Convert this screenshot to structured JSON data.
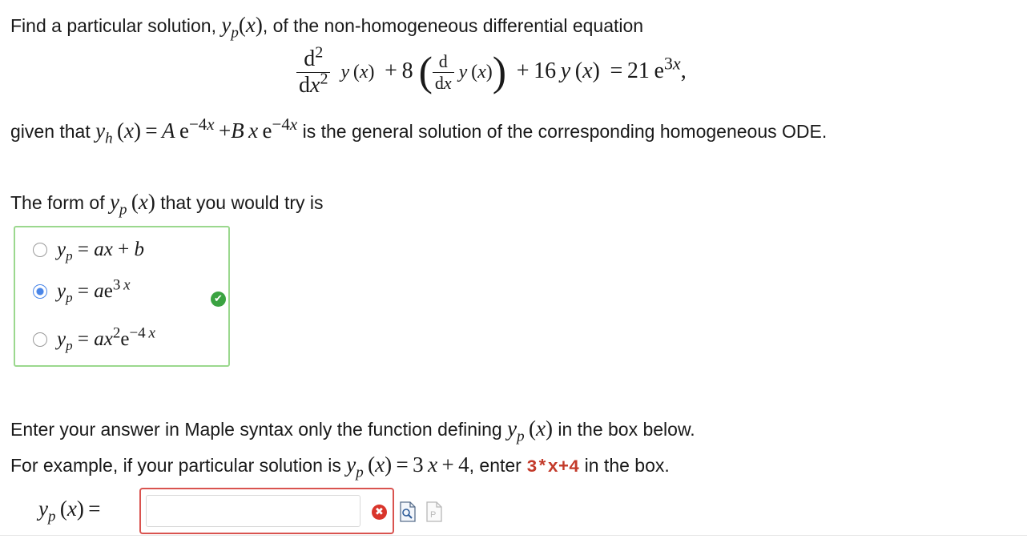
{
  "top_cut_text": "",
  "prompt": {
    "line1_before": "Find a particular solution, ",
    "line1_after": ", of the non-homogeneous differential equation",
    "given_prefix": "given that ",
    "given_suffix": " is the general solution of the corresponding homogeneous ODE."
  },
  "equation": {
    "rhs_coeff": "21",
    "first_coeff": "8",
    "second_coeff": "16"
  },
  "form_prompt_before": "The form of ",
  "form_prompt_after": " that you would try is",
  "choices": [
    {
      "label": "y_p = ax + b",
      "selected": false
    },
    {
      "label": "y_p = a e^{3x}",
      "selected": true,
      "correct": true
    },
    {
      "label": "y_p = a x^2 e^{-4x}",
      "selected": false
    }
  ],
  "instructions": {
    "line1_before": "Enter your answer in Maple syntax only the function defining ",
    "line1_after": " in the box below.",
    "line2_before": "For example, if your particular solution is ",
    "line2_mid": ",  enter ",
    "example_code": "3*x+4",
    "line2_after": " in the box."
  },
  "answer": {
    "value": "",
    "placeholder": ""
  },
  "icons": {
    "correct": "check-circle-icon",
    "error": "x-circle-icon",
    "preview": "preview-document-icon",
    "paste": "paste-document-icon"
  },
  "colors": {
    "correct_border": "#9bd88e",
    "error_border": "#d9534f",
    "selected_radio": "#4a86e8",
    "code_text": "#c33a2a"
  }
}
